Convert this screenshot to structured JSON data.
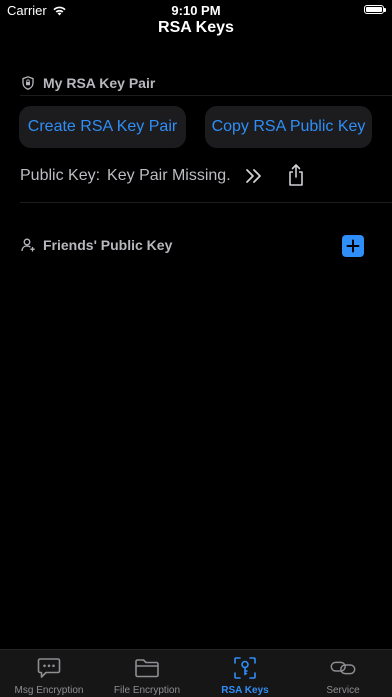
{
  "status": {
    "carrier": "Carrier",
    "time": "9:10 PM"
  },
  "nav": {
    "title": "RSA Keys"
  },
  "my_keys": {
    "header": "My RSA Key Pair",
    "create_label": "Create RSA Key Pair",
    "copy_label": "Copy RSA Public Key",
    "public_key_label": "Public Key:",
    "public_key_value": "Key Pair Missing."
  },
  "friends": {
    "header": "Friends' Public Key"
  },
  "tabs": [
    {
      "label": "Msg Encryption",
      "icon": "message-icon"
    },
    {
      "label": "File Encryption",
      "icon": "folder-icon"
    },
    {
      "label": "RSA Keys",
      "icon": "key-icon",
      "active": true
    },
    {
      "label": "Service",
      "icon": "link-icon"
    }
  ],
  "colors": {
    "accent": "#2f8ef7",
    "background": "#000000",
    "button_bg": "#1c1c1e"
  }
}
